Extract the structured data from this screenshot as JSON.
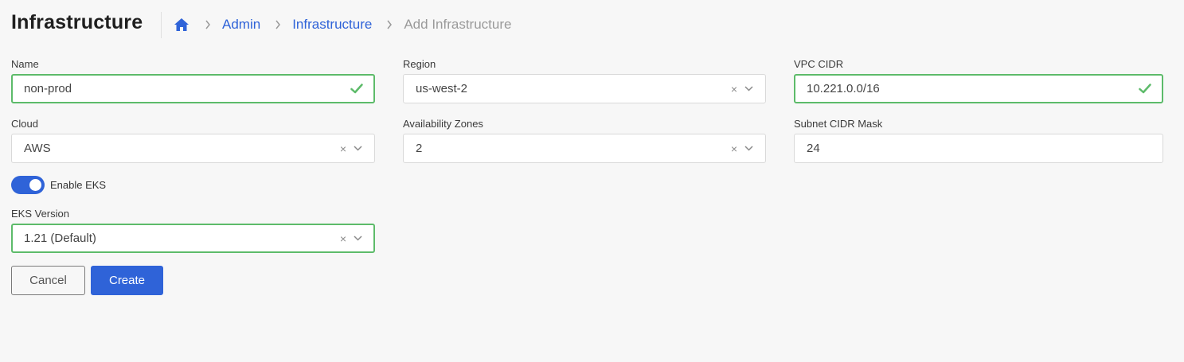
{
  "header": {
    "title": "Infrastructure",
    "breadcrumb": {
      "home_icon": "home-icon",
      "items": [
        "Admin",
        "Infrastructure",
        "Add Infrastructure"
      ]
    }
  },
  "form": {
    "name": {
      "label": "Name",
      "value": "non-prod",
      "state": "valid"
    },
    "region": {
      "label": "Region",
      "value": "us-west-2"
    },
    "vpc_cidr": {
      "label": "VPC CIDR",
      "value": "10.221.0.0/16",
      "state": "valid"
    },
    "cloud": {
      "label": "Cloud",
      "value": "AWS"
    },
    "availability_zones": {
      "label": "Availability Zones",
      "value": "2"
    },
    "subnet_cidr_mask": {
      "label": "Subnet CIDR Mask",
      "value": "24"
    },
    "enable_eks": {
      "label": "Enable EKS",
      "enabled": true
    },
    "eks_version": {
      "label": "EKS Version",
      "value": "1.21 (Default)"
    },
    "clear_glyph": "×"
  },
  "actions": {
    "cancel_label": "Cancel",
    "create_label": "Create"
  },
  "colors": {
    "accent": "#2f63d8",
    "valid": "#5dbb6a",
    "background": "#f7f7f7"
  }
}
